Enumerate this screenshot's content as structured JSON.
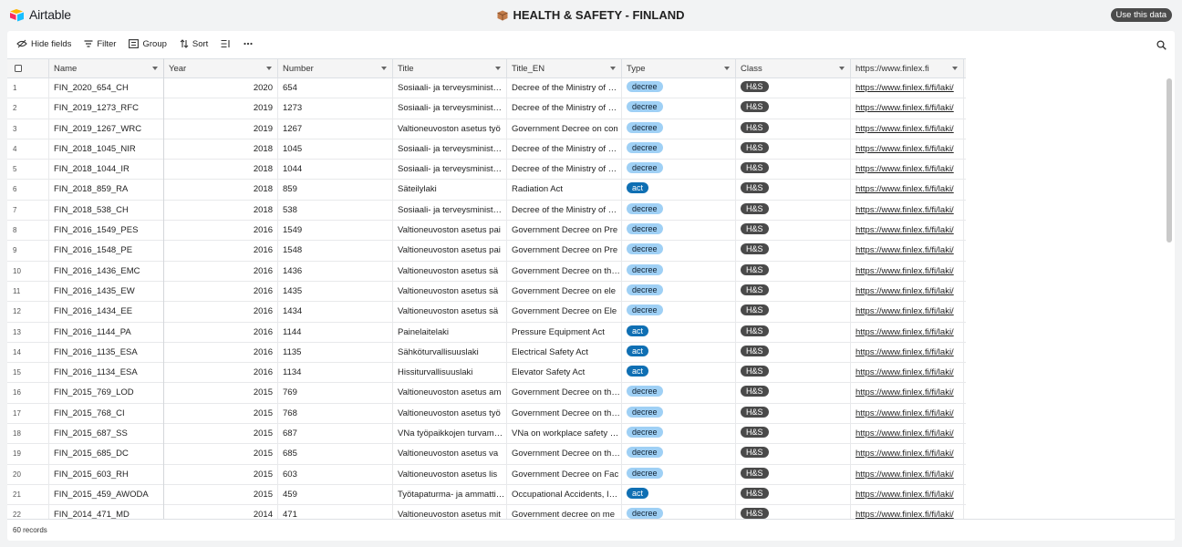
{
  "app": {
    "name": "Airtable",
    "base_title": "HEALTH & SAFETY - FINLAND",
    "use_button": "Use this data"
  },
  "toolbar": {
    "hide_fields": "Hide fields",
    "filter": "Filter",
    "group": "Group",
    "sort": "Sort"
  },
  "columns": [
    "Name",
    "Year",
    "Number",
    "Title",
    "Title_EN",
    "Type",
    "Class",
    "https://www.finlex.fi"
  ],
  "colors": {
    "decree": "#9fd0f5",
    "act": "#0f6fb3",
    "class": "#4a4a4a"
  },
  "rows": [
    {
      "n": "1",
      "name": "FIN_2020_654_CH",
      "year": "2020",
      "number": "654",
      "title": "Sosiaali- ja terveysministeriön asetus",
      "title_en": "Decree of the Ministry of Social Affairs",
      "type": "decree",
      "cls": "H&S",
      "url": "https://www.finlex.fi/fi/laki/"
    },
    {
      "n": "2",
      "name": "FIN_2019_1273_RFC",
      "year": "2019",
      "number": "1273",
      "title": "Sosiaali- ja terveysministeriön asetus",
      "title_en": "Decree of the Ministry of Social Affairs",
      "type": "decree",
      "cls": "H&S",
      "url": "https://www.finlex.fi/fi/laki/"
    },
    {
      "n": "3",
      "name": "FIN_2019_1267_WRC",
      "year": "2019",
      "number": "1267",
      "title": "Valtioneuvoston asetus työ",
      "title_en": "Government Decree on con",
      "type": "decree",
      "cls": "H&S",
      "url": "https://www.finlex.fi/fi/laki/"
    },
    {
      "n": "4",
      "name": "FIN_2018_1045_NIR",
      "year": "2018",
      "number": "1045",
      "title": "Sosiaali- ja terveysministeriön asetus",
      "title_en": "Decree of the Ministry of Social Affairs",
      "type": "decree",
      "cls": "H&S",
      "url": "https://www.finlex.fi/fi/laki/"
    },
    {
      "n": "5",
      "name": "FIN_2018_1044_IR",
      "year": "2018",
      "number": "1044",
      "title": "Sosiaali- ja terveysministeriön asetus",
      "title_en": "Decree of the Ministry of Social Affairs",
      "type": "decree",
      "cls": "H&S",
      "url": "https://www.finlex.fi/fi/laki/"
    },
    {
      "n": "6",
      "name": "FIN_2018_859_RA",
      "year": "2018",
      "number": "859",
      "title": "Säteilylaki",
      "title_en": "Radiation Act",
      "type": "act",
      "cls": "H&S",
      "url": "https://www.finlex.fi/fi/laki/"
    },
    {
      "n": "7",
      "name": "FIN_2018_538_CH",
      "year": "2018",
      "number": "538",
      "title": "Sosiaali- ja terveysministeriön asetus",
      "title_en": "Decree of the Ministry of Social Affairs",
      "type": "decree",
      "cls": "H&S",
      "url": "https://www.finlex.fi/fi/laki/"
    },
    {
      "n": "8",
      "name": "FIN_2016_1549_PES",
      "year": "2016",
      "number": "1549",
      "title": "Valtioneuvoston asetus pai",
      "title_en": "Government Decree on Pre",
      "type": "decree",
      "cls": "H&S",
      "url": "https://www.finlex.fi/fi/laki/"
    },
    {
      "n": "9",
      "name": "FIN_2016_1548_PE",
      "year": "2016",
      "number": "1548",
      "title": "Valtioneuvoston asetus pai",
      "title_en": "Government Decree on Pre",
      "type": "decree",
      "cls": "H&S",
      "url": "https://www.finlex.fi/fi/laki/"
    },
    {
      "n": "10",
      "name": "FIN_2016_1436_EMC",
      "year": "2016",
      "number": "1436",
      "title": "Valtioneuvoston asetus sä",
      "title_en": "Government Decree on the E",
      "type": "decree",
      "cls": "H&S",
      "url": "https://www.finlex.fi/fi/laki/"
    },
    {
      "n": "11",
      "name": "FIN_2016_1435_EW",
      "year": "2016",
      "number": "1435",
      "title": "Valtioneuvoston asetus sä",
      "title_en": "Government Decree on ele",
      "type": "decree",
      "cls": "H&S",
      "url": "https://www.finlex.fi/fi/laki/"
    },
    {
      "n": "12",
      "name": "FIN_2016_1434_EE",
      "year": "2016",
      "number": "1434",
      "title": "Valtioneuvoston asetus sä",
      "title_en": "Government Decree on Ele",
      "type": "decree",
      "cls": "H&S",
      "url": "https://www.finlex.fi/fi/laki/"
    },
    {
      "n": "13",
      "name": "FIN_2016_1144_PA",
      "year": "2016",
      "number": "1144",
      "title": "Painelaitelaki",
      "title_en": "Pressure Equipment Act",
      "type": "act",
      "cls": "H&S",
      "url": "https://www.finlex.fi/fi/laki/"
    },
    {
      "n": "14",
      "name": "FIN_2016_1135_ESA",
      "year": "2016",
      "number": "1135",
      "title": "Sähköturvallisuuslaki",
      "title_en": "Electrical Safety Act",
      "type": "act",
      "cls": "H&S",
      "url": "https://www.finlex.fi/fi/laki/"
    },
    {
      "n": "15",
      "name": "FIN_2016_1134_ESA",
      "year": "2016",
      "number": "1134",
      "title": "Hissiturvallisuuslaki",
      "title_en": "Elevator Safety Act",
      "type": "act",
      "cls": "H&S",
      "url": "https://www.finlex.fi/fi/laki/"
    },
    {
      "n": "16",
      "name": "FIN_2015_769_LOD",
      "year": "2015",
      "number": "769",
      "title": "Valtioneuvoston asetus am",
      "title_en": "Government Decree on the L",
      "type": "decree",
      "cls": "H&S",
      "url": "https://www.finlex.fi/fi/laki/"
    },
    {
      "n": "17",
      "name": "FIN_2015_768_CI",
      "year": "2015",
      "number": "768",
      "title": "Valtioneuvoston asetus työ",
      "title_en": "Government Decree on the C",
      "type": "decree",
      "cls": "H&S",
      "url": "https://www.finlex.fi/fi/laki/"
    },
    {
      "n": "18",
      "name": "FIN_2015_687_SS",
      "year": "2015",
      "number": "687",
      "title": "VNa työpaikkojen turvamerkeistä",
      "title_en": "VNa on workplace safety signs",
      "type": "decree",
      "cls": "H&S",
      "url": "https://www.finlex.fi/fi/laki/"
    },
    {
      "n": "19",
      "name": "FIN_2015_685_DC",
      "year": "2015",
      "number": "685",
      "title": "Valtioneuvoston asetus va",
      "title_en": "Government Decree on the D",
      "type": "decree",
      "cls": "H&S",
      "url": "https://www.finlex.fi/fi/laki/"
    },
    {
      "n": "20",
      "name": "FIN_2015_603_RH",
      "year": "2015",
      "number": "603",
      "title": "Valtioneuvoston asetus lis",
      "title_en": "Government Decree on Fac",
      "type": "decree",
      "cls": "H&S",
      "url": "https://www.finlex.fi/fi/laki/"
    },
    {
      "n": "21",
      "name": "FIN_2015_459_AWODA",
      "year": "2015",
      "number": "459",
      "title": "Työtapaturma- ja ammattitautilaki",
      "title_en": "Occupational Accidents, Injuries",
      "type": "act",
      "cls": "H&S",
      "url": "https://www.finlex.fi/fi/laki/"
    },
    {
      "n": "22",
      "name": "FIN_2014_471_MD",
      "year": "2014",
      "number": "471",
      "title": "Valtioneuvoston asetus mit",
      "title_en": "Government decree on me",
      "type": "decree",
      "cls": "H&S",
      "url": "https://www.finlex.fi/fi/laki/"
    }
  ],
  "footer": {
    "records": "60 records"
  }
}
